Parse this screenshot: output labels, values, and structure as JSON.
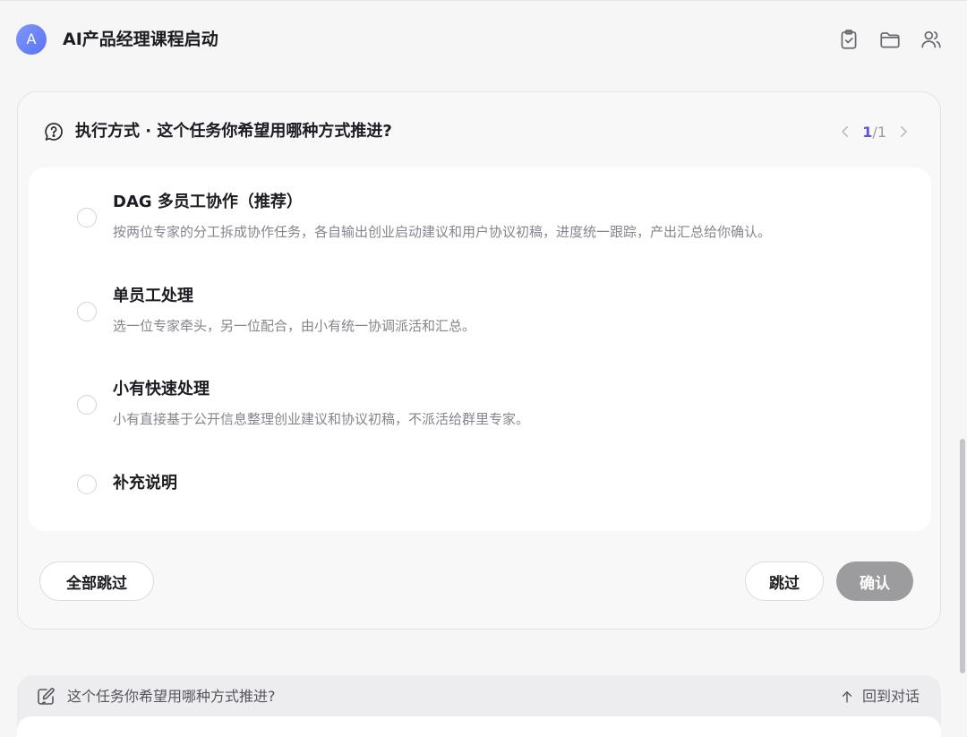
{
  "header": {
    "avatar_letter": "A",
    "title": "AI产品经理课程启动",
    "icons": [
      "clipboard-check-icon",
      "folder-icon",
      "users-icon"
    ]
  },
  "question": {
    "icon": "question-bubble-icon",
    "text": "执行方式 · 这个任务你希望用哪种方式推进?",
    "pager": {
      "current": "1",
      "separator": "/",
      "total": "1"
    }
  },
  "options": [
    {
      "title": "DAG 多员工协作（推荐）",
      "desc": "按两位专家的分工拆成协作任务，各自输出创业启动建议和用户协议初稿，进度统一跟踪，产出汇总给你确认。"
    },
    {
      "title": "单员工处理",
      "desc": "选一位专家牵头，另一位配合，由小有统一协调派活和汇总。"
    },
    {
      "title": "小有快速处理",
      "desc": "小有直接基于公开信息整理创业建议和协议初稿，不派活给群里专家。"
    },
    {
      "title": "补充说明",
      "desc": ""
    }
  ],
  "actions": {
    "skip_all": "全部跳过",
    "skip": "跳过",
    "confirm": "确认"
  },
  "bottom_bar": {
    "icon": "edit-note-icon",
    "text": "这个任务你希望用哪种方式推进?",
    "back_label": "回到对话"
  },
  "colors": {
    "accent": "#5b56d6",
    "avatar": "#6b83f5",
    "confirm_disabled": "#9c9c9f"
  }
}
